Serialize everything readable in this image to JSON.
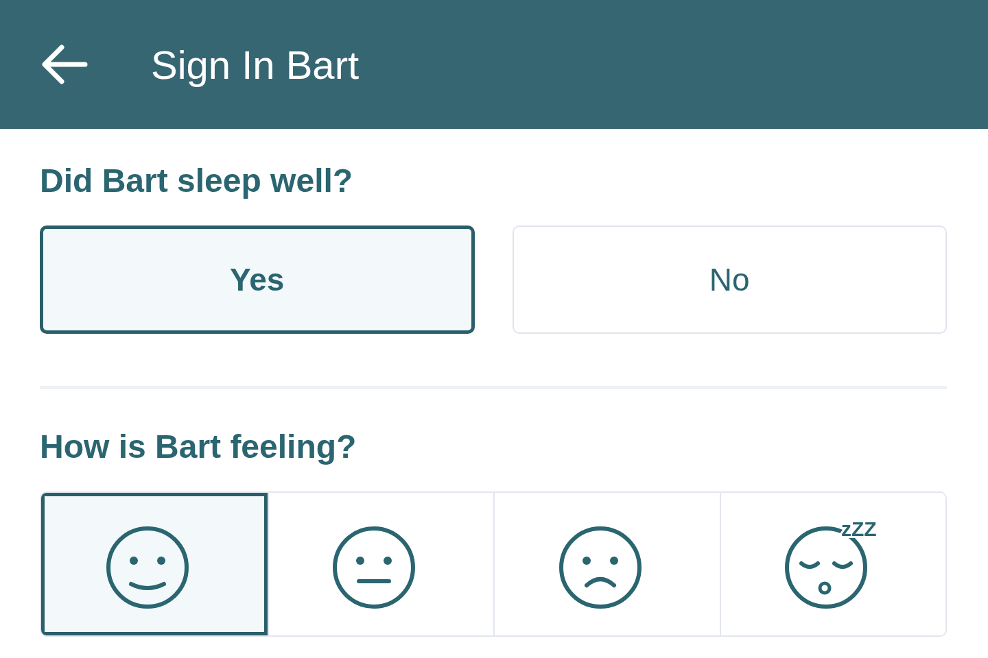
{
  "header": {
    "title": "Sign In Bart"
  },
  "sleep": {
    "question": "Did Bart sleep well?",
    "options": [
      {
        "label": "Yes",
        "selected": true
      },
      {
        "label": "No",
        "selected": false
      }
    ]
  },
  "feeling": {
    "question": "How is Bart feeling?",
    "options": [
      {
        "kind": "happy",
        "selected": true
      },
      {
        "kind": "neutral",
        "selected": false
      },
      {
        "kind": "sad",
        "selected": false
      },
      {
        "kind": "sleepy",
        "selected": false,
        "badge": "zZZ"
      }
    ]
  }
}
